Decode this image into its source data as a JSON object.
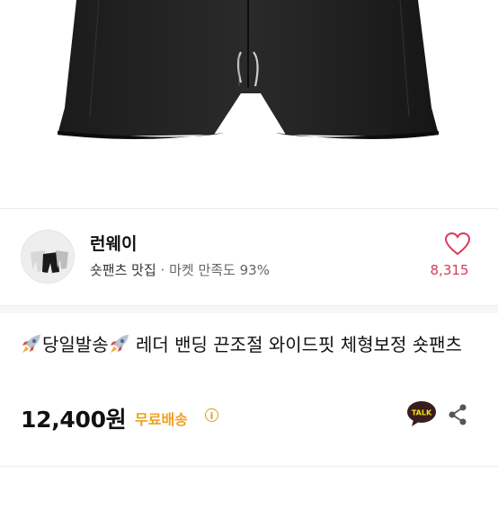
{
  "seller": {
    "name": "런웨이",
    "tagline": "숏팬츠 맛집",
    "separator": " · ",
    "satisfaction": "마켓 만족도 93%",
    "likes": "8,315"
  },
  "product": {
    "title_text": "당일발송",
    "title_rest": " 레더 밴딩 끈조절 와이드핏 체형보정 숏팬츠",
    "price": "12,400원",
    "shipping": "무료배송",
    "info_glyph": "i"
  },
  "talk_badge": "TALK",
  "icons": [
    "heart-icon",
    "rocket-icon",
    "info-icon",
    "kakaotalk-icon",
    "share-icon"
  ],
  "colors": {
    "heart": "#d93a5c",
    "shipping": "#f0a020",
    "talk_bg": "#3a1d1d",
    "talk_yellow": "#f7e316"
  }
}
